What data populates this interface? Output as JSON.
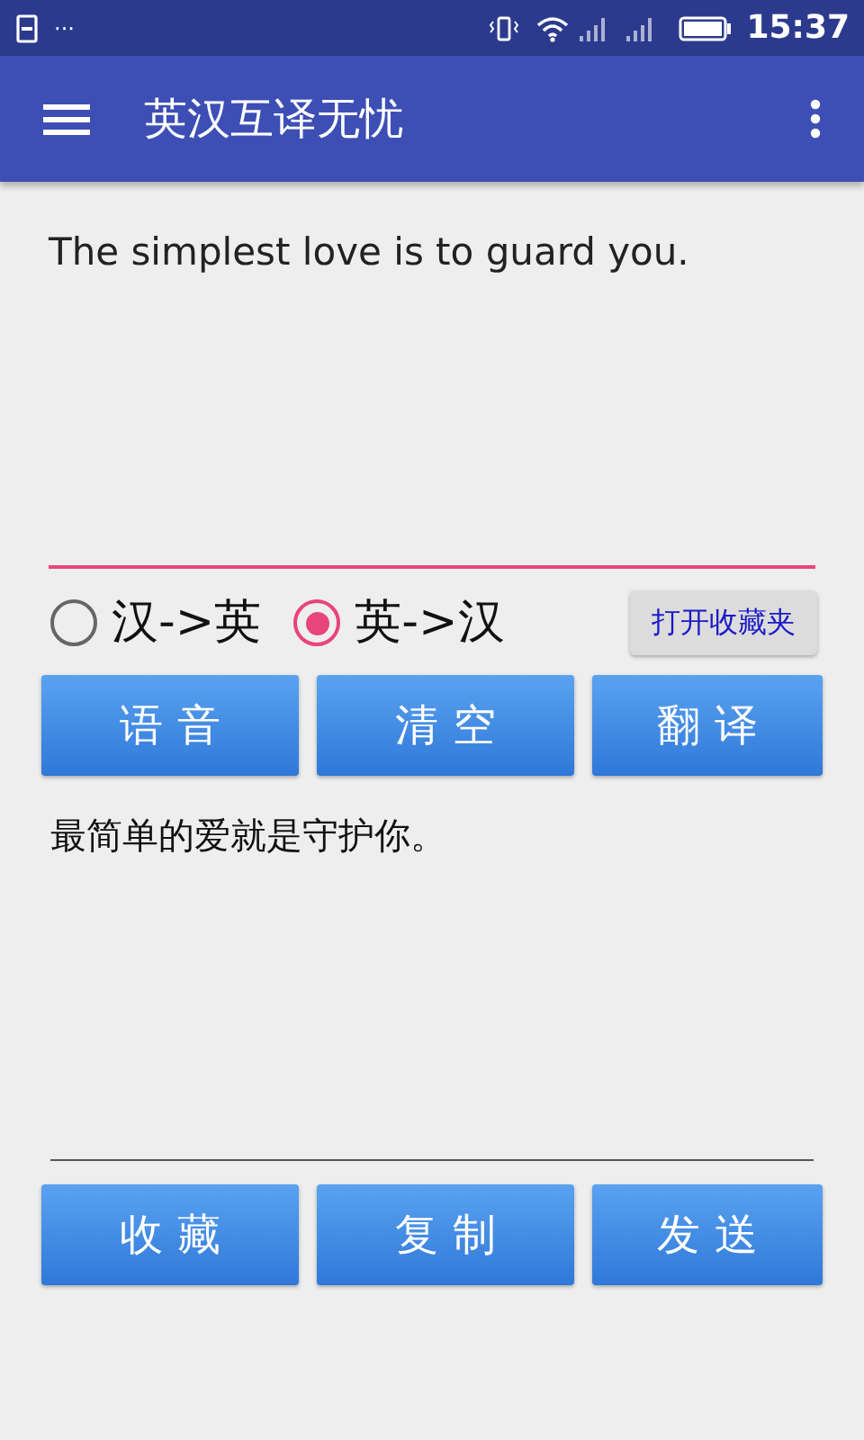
{
  "status_bar": {
    "notification_dots": "···",
    "time": "15:37"
  },
  "app_bar": {
    "title": "英汉互译无忧"
  },
  "input": {
    "value": "The simplest love is to guard you."
  },
  "directions": [
    {
      "label": "汉->英",
      "selected": false
    },
    {
      "label": "英->汉",
      "selected": true
    }
  ],
  "favorites_button": "打开收藏夹",
  "actions": [
    "语 音",
    "清 空",
    "翻 译"
  ],
  "output": {
    "value": "最简单的爱就是守护你。"
  },
  "bottom_actions": [
    "收 藏",
    "复 制",
    "发 送"
  ]
}
